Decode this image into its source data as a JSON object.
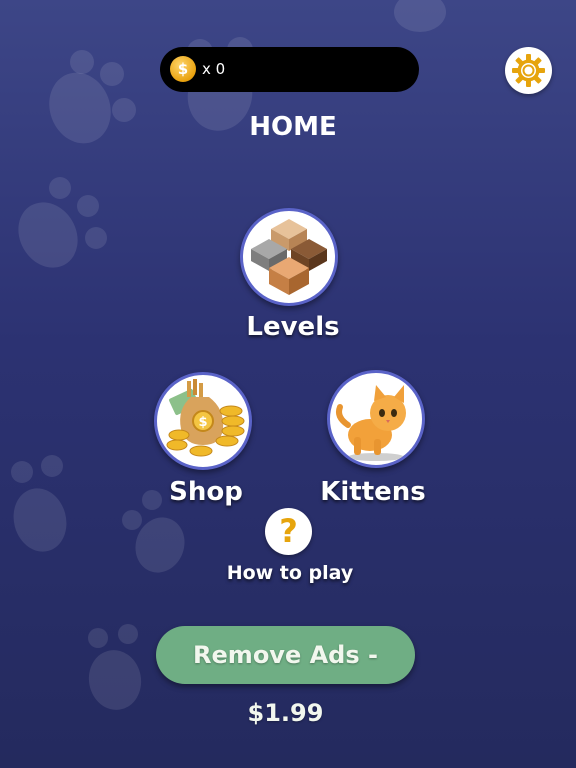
{
  "header": {
    "coin_symbol": "$",
    "coin_count_text": "x 0",
    "settings_icon": "gear-icon"
  },
  "screen": {
    "title": "HOME"
  },
  "menu": {
    "levels_label": "Levels",
    "shop_label": "Shop",
    "kittens_label": "Kittens",
    "help_symbol": "?",
    "help_label": "How to play"
  },
  "purchase": {
    "remove_ads_label": "Remove Ads - $1.99"
  },
  "colors": {
    "accent_gold": "#e6a40d",
    "button_green": "#6fae84",
    "circle_border": "#5a63c8",
    "background": "#2c3272"
  }
}
